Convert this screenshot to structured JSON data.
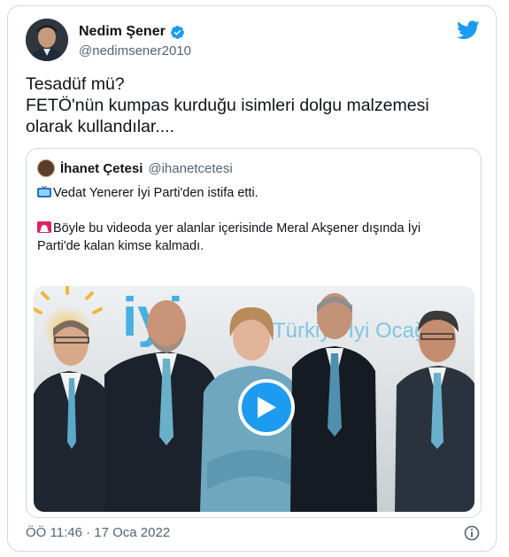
{
  "author": {
    "name": "Nedim Şener",
    "handle": "@nedimsener2010"
  },
  "tweet": {
    "lines": [
      "Tesadüf mü?",
      "FETÖ'nün kumpas kurduğu isimleri dolgu malzemesi",
      "olarak kullandılar...."
    ]
  },
  "quoted": {
    "name": "İhanet Çetesi",
    "handle": "@ihanetcetesi",
    "line1": "Vedat Yenerer İyi Parti'den istifa etti.",
    "line2a": "Böyle bu videoda yer alanlar içerisinde Meral Akşener dışında İyi",
    "line2b": "Parti'de kalan kimse kalmadı.",
    "video_sign_logo": "iyi",
    "video_sign_text": "Türkiye İyi Ocağı"
  },
  "footer": {
    "timestamp": "ÖÖ 11:46 · 17 Oca 2022"
  },
  "colors": {
    "accent": "#1d9bf0",
    "text": "#0f1419",
    "muted": "#536471"
  },
  "icons": [
    "verified-badge-icon",
    "twitter-bird-icon",
    "tv-emoji-icon",
    "siren-emoji-icon",
    "play-icon",
    "info-icon"
  ]
}
